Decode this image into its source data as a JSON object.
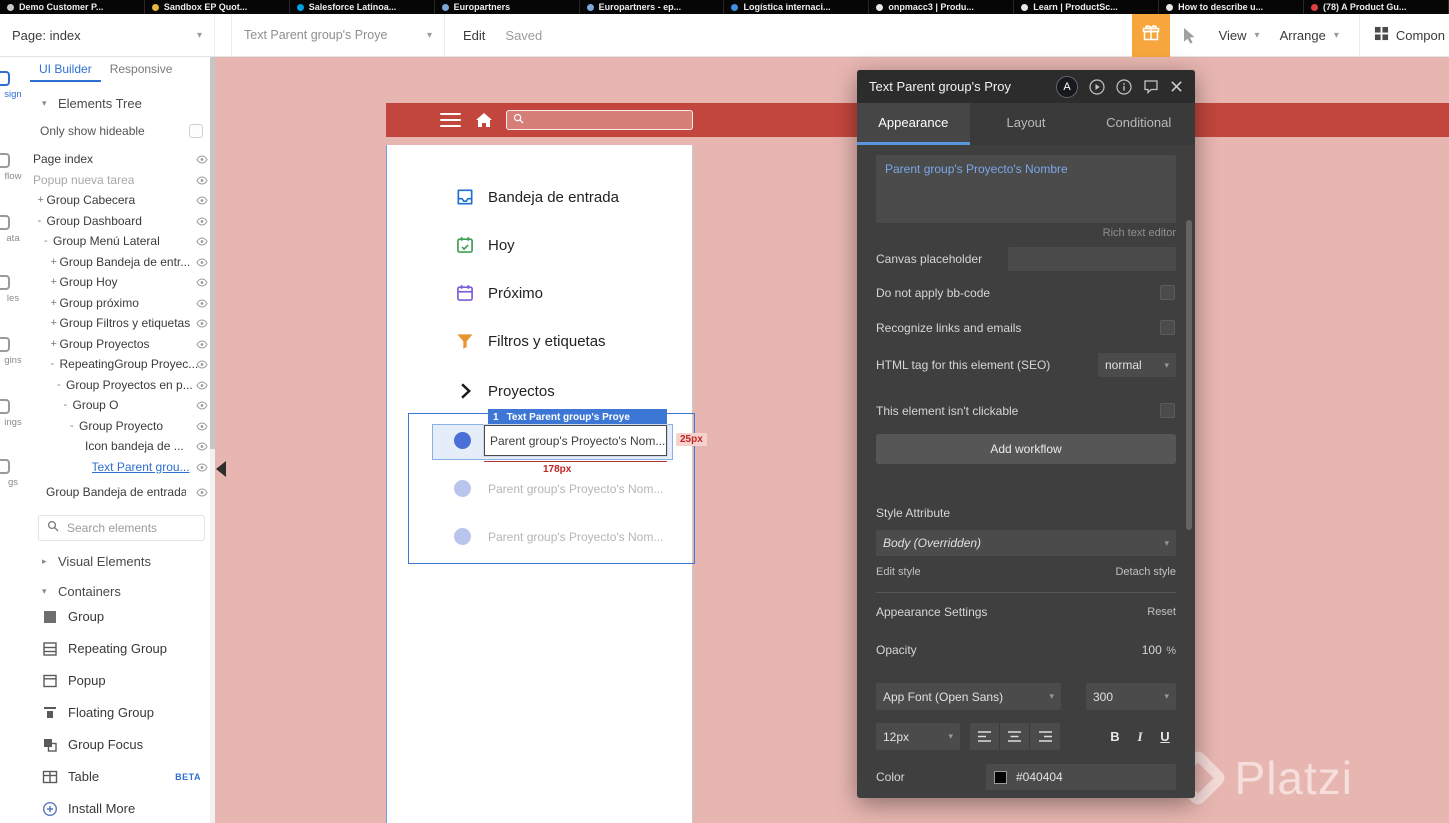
{
  "colors": {
    "accent": "#2e6fd0",
    "selection": "#3d77d6",
    "canvas_bg": "#e8b6b1",
    "header_red": "#c2463d",
    "panel_bg": "#3f3f3f",
    "orange": "#f6a63d"
  },
  "icons": {
    "chevron_down": "▾",
    "chevron_right": "▸"
  },
  "browser": {
    "tabs": [
      {
        "label": "Demo Customer P...",
        "favicon_color": "#c9c9c9"
      },
      {
        "label": "Sandbox EP Quot...",
        "favicon_color": "#e3b93c"
      },
      {
        "label": "Salesforce Latinoa...",
        "favicon_color": "#00a1e0"
      },
      {
        "label": "Europartners",
        "favicon_color": "#7ea6d9"
      },
      {
        "label": "Europartners - ep...",
        "favicon_color": "#7ea6d9"
      },
      {
        "label": "Logística internaci...",
        "favicon_color": "#3d8fe0"
      },
      {
        "label": "onpmacc3 | Produ...",
        "favicon_color": "#e8e8e8"
      },
      {
        "label": "Learn | ProductSc...",
        "favicon_color": "#e8e8e8"
      },
      {
        "label": "How to describe u...",
        "favicon_color": "#e8e8e8"
      },
      {
        "label": "(78) A Product Gu...",
        "favicon_color": "#e04040"
      }
    ]
  },
  "toolbar": {
    "page_selector": "Page: index",
    "element_selector": "Text Parent group's Proye",
    "edit_label": "Edit",
    "saved_label": "Saved",
    "view_label": "View",
    "arrange_label": "Arrange",
    "components_label": "Compon"
  },
  "left_nav": {
    "items": [
      {
        "label": "sign",
        "active": true
      },
      {
        "label": "flow",
        "active": false
      },
      {
        "label": "ata",
        "active": false
      },
      {
        "label": "les",
        "active": false
      },
      {
        "label": "gins",
        "active": false
      },
      {
        "label": "ings",
        "active": false
      },
      {
        "label": "gs",
        "active": false
      }
    ]
  },
  "sidebar": {
    "tabs": [
      {
        "label": "UI Builder",
        "active": true
      },
      {
        "label": "Responsive",
        "active": false
      }
    ],
    "elements_tree_label": "Elements Tree",
    "only_show_hideable_label": "Only show hideable",
    "tree": [
      {
        "label": "Page index",
        "depth": 0
      },
      {
        "label": "Popup nueva tarea",
        "depth": 0,
        "muted": true
      },
      {
        "label": "Group Cabecera",
        "depth": 1,
        "expander": "+"
      },
      {
        "label": "Group Dashboard",
        "depth": 1,
        "expander": "-"
      },
      {
        "label": "Group Menú Lateral",
        "depth": 2,
        "expander": "-"
      },
      {
        "label": "Group Bandeja de entr...",
        "depth": 3,
        "expander": "+"
      },
      {
        "label": "Group Hoy",
        "depth": 3,
        "expander": "+"
      },
      {
        "label": "Group próximo",
        "depth": 3,
        "expander": "+"
      },
      {
        "label": "Group Filtros y etiquetas",
        "depth": 3,
        "expander": "+"
      },
      {
        "label": "Group Proyectos",
        "depth": 3,
        "expander": "+"
      },
      {
        "label": "RepeatingGroup Proyec...",
        "depth": 3,
        "expander": "-"
      },
      {
        "label": "Group Proyectos en p...",
        "depth": 4,
        "expander": "-"
      },
      {
        "label": "Group O",
        "depth": 5,
        "expander": "-"
      },
      {
        "label": "Group Proyecto",
        "depth": 6,
        "expander": "-"
      },
      {
        "label": "Icon bandeja de ...",
        "depth": 8
      },
      {
        "label": "Text Parent grou...",
        "depth": 9,
        "selected": true
      },
      {
        "label": "Group Bandeja de entrada",
        "depth": 2,
        "last": true
      }
    ],
    "search_placeholder": "Search elements",
    "visual_elements_label": "Visual Elements",
    "containers_label": "Containers",
    "containers": [
      {
        "label": "Group"
      },
      {
        "label": "Repeating Group"
      },
      {
        "label": "Popup"
      },
      {
        "label": "Floating Group"
      },
      {
        "label": "Group Focus"
      },
      {
        "label": "Table",
        "badge": "BETA"
      },
      {
        "label": "Install More"
      }
    ]
  },
  "canvas": {
    "menu_items": [
      {
        "label": "Bandeja de entrada",
        "icon": "inbox-icon",
        "color": "#1d6fd1"
      },
      {
        "label": "Hoy",
        "icon": "calendar-check-icon",
        "color": "#3f9e53"
      },
      {
        "label": "Próximo",
        "icon": "calendar-icon",
        "color": "#7c5cd6"
      },
      {
        "label": "Filtros y etiquetas",
        "icon": "funnel-icon",
        "color": "#e8952e"
      },
      {
        "label": "Proyectos",
        "icon": "chevron-right-icon",
        "color": "#1c1c1c"
      }
    ],
    "rows": [
      "Parent group's Proyecto's Nom...",
      "Parent group's Proyecto's Nom...",
      "Parent group's Proyecto's Nom..."
    ],
    "selection": {
      "badge_index": "1",
      "badge_label": "Text Parent group's Proye",
      "width_label": "178px",
      "height_label": "25px"
    }
  },
  "inspector": {
    "title": "Text Parent group's Proy",
    "tabs": [
      {
        "label": "Appearance",
        "active": true
      },
      {
        "label": "Layout",
        "active": false
      },
      {
        "label": "Conditional",
        "active": false
      }
    ],
    "avatar_label": "A",
    "text_value": "Parent group's Proyecto's Nombre",
    "rich_text_editor_label": "Rich text editor",
    "canvas_placeholder_label": "Canvas placeholder",
    "bb_code_label": "Do not apply bb-code",
    "recognize_links_label": "Recognize links and emails",
    "html_tag_label": "HTML tag for this element (SEO)",
    "html_tag_value": "normal",
    "not_clickable_label": "This element isn't clickable",
    "add_workflow_label": "Add workflow",
    "style_attribute_label": "Style Attribute",
    "style_value": "Body (Overridden)",
    "edit_style_label": "Edit style",
    "detach_style_label": "Detach style",
    "appearance_settings_label": "Appearance Settings",
    "reset_label": "Reset",
    "opacity_label": "Opacity",
    "opacity_value": "100",
    "opacity_unit": "%",
    "font_value": "App Font (Open Sans)",
    "font_weight_value": "300",
    "font_size_value": "12px",
    "bold_label": "B",
    "italic_label": "I",
    "underline_label": "U",
    "color_label": "Color",
    "color_value": "#040404"
  },
  "watermark": {
    "text": "Platzi"
  }
}
